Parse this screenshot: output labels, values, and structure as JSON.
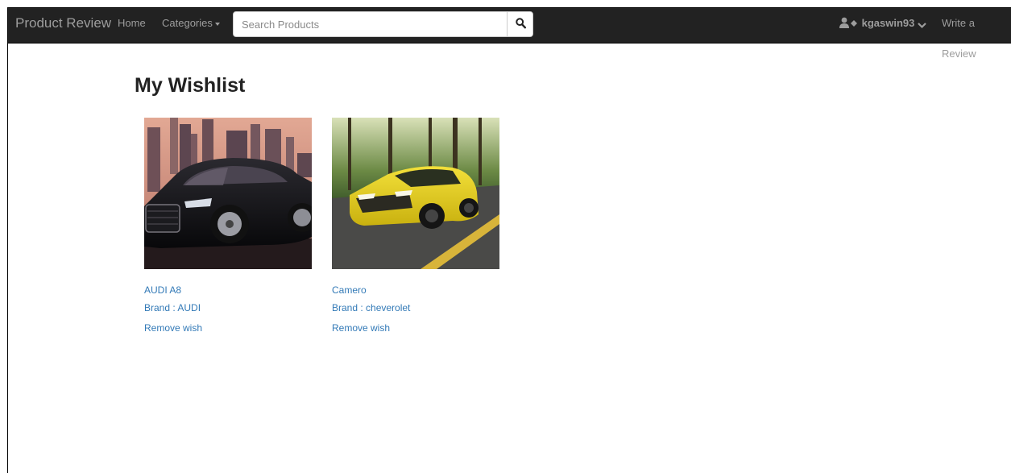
{
  "navbar": {
    "brand": "Product Review",
    "home_label": "Home",
    "categories_label": "Categories",
    "search_placeholder": "Search Products",
    "username": "kgaswin93",
    "write_review_label": "Write a Review"
  },
  "main": {
    "title": "My Wishlist",
    "items": [
      {
        "name": "AUDI A8",
        "brand": "Brand : AUDI",
        "remove_label": "Remove wish"
      },
      {
        "name": "Camero",
        "brand": "Brand : cheverolet",
        "remove_label": "Remove wish"
      }
    ]
  },
  "colors": {
    "navbar_bg": "#222222",
    "nav_text": "#9d9d9d",
    "link": "#337ab7",
    "audi_car": "#121215",
    "camaro_car": "#e9d51f"
  },
  "icons": [
    "search-icon",
    "user-icon",
    "chevron-down-icon"
  ]
}
